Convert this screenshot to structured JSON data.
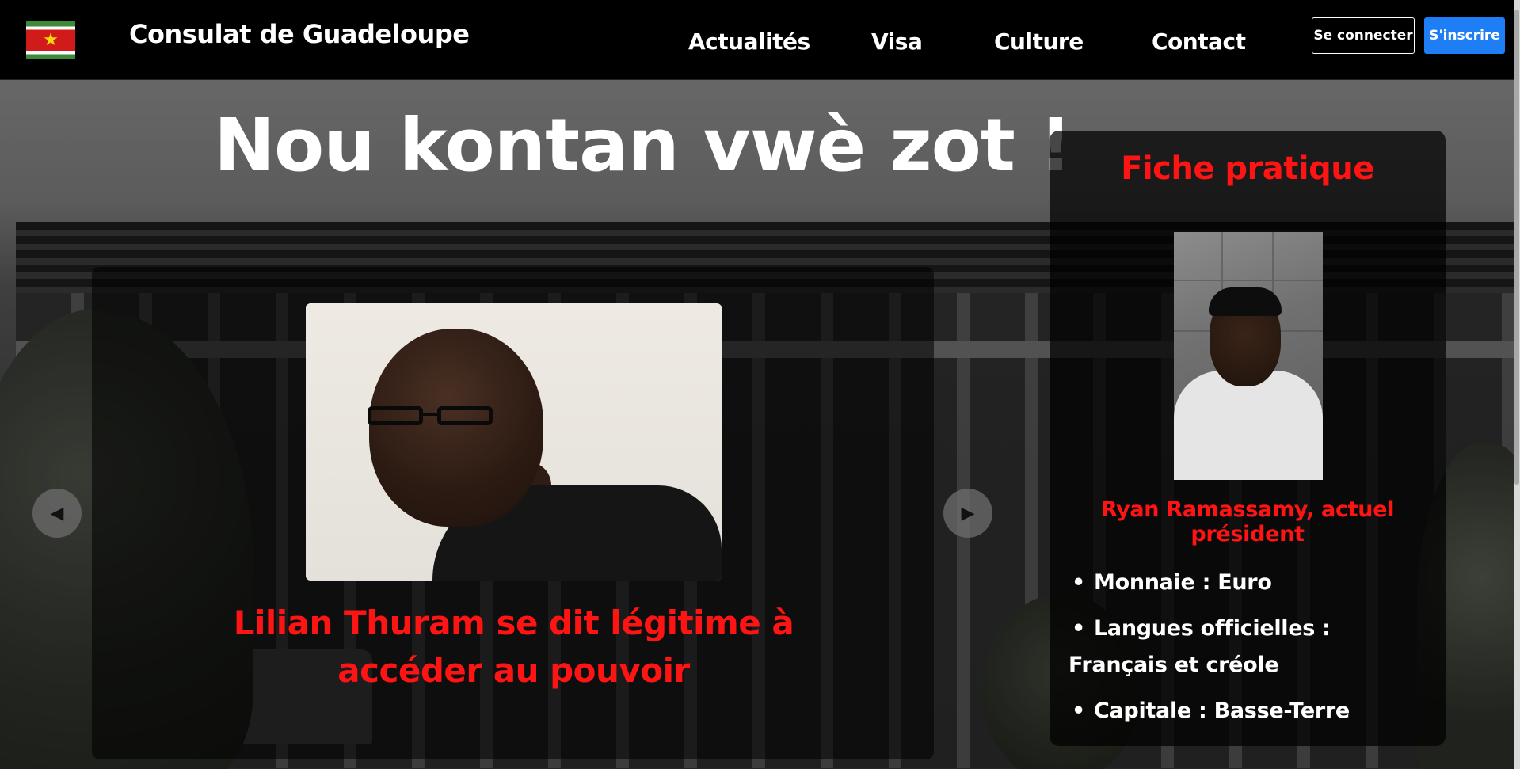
{
  "navbar": {
    "brand": "Consulat de Guadeloupe",
    "links": [
      "Actualités",
      "Visa",
      "Culture",
      "Contact"
    ],
    "login_label": "Se connecter",
    "signup_label": "S'inscrire"
  },
  "hero": {
    "title": "Nou kontan vwè zot !"
  },
  "carousel": {
    "caption": "Lilian Thuram se dit légitime à accéder au pouvoir",
    "prev_icon": "◀",
    "next_icon": "▶"
  },
  "fiche": {
    "title": "Fiche pratique",
    "photo_caption": "Ryan Ramassamy, actuel président",
    "facts": [
      "Monnaie : Euro",
      "Langues officielles : Français et créole",
      "Capitale : Basse-Terre"
    ]
  },
  "colors": {
    "accent_red": "#ff1414",
    "signup_blue": "#1e7ef5",
    "navbar_bg": "#000000"
  },
  "icons": {
    "flag": "guadeloupe-flag-icon",
    "prev": "triangle-left-icon",
    "next": "triangle-right-icon"
  }
}
